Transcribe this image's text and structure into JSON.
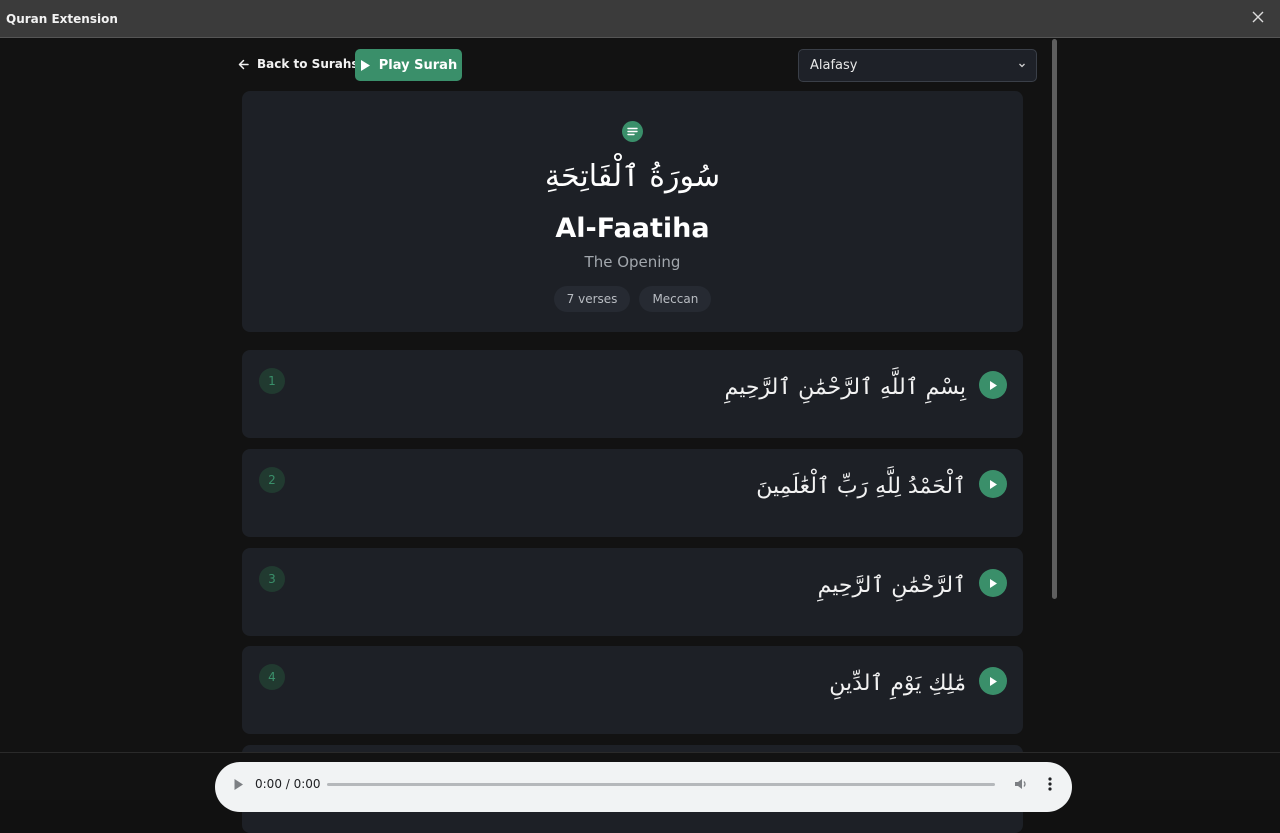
{
  "window": {
    "title": "Quran Extension"
  },
  "toolbar": {
    "back_label": "Back to Surahs",
    "play_label": "Play Surah",
    "reciter_selected": "Alafasy"
  },
  "surah": {
    "arabic_name": "سُورَةُ ٱلْفَاتِحَةِ",
    "english_name": "Al-Faatiha",
    "translation": "The Opening",
    "verses_badge": "7 verses",
    "revelation_badge": "Meccan"
  },
  "verses": [
    {
      "number": "1",
      "text": "بِسْمِ ٱللَّهِ ٱلرَّحْمَٰنِ ٱلرَّحِيمِ"
    },
    {
      "number": "2",
      "text": "ٱلْحَمْدُ لِلَّهِ رَبِّ ٱلْعَٰلَمِينَ"
    },
    {
      "number": "3",
      "text": "ٱلرَّحْمَٰنِ ٱلرَّحِيمِ"
    },
    {
      "number": "4",
      "text": "مَٰلِكِ يَوْمِ ٱلدِّينِ"
    }
  ],
  "audio": {
    "time": "0:00 / 0:00",
    "progress": 0
  },
  "colors": {
    "accent": "#3a8f6a",
    "card": "#1d2026",
    "background": "#121212"
  },
  "icons": [
    "close-icon",
    "arrow-left-icon",
    "play-icon",
    "chevron-down-icon",
    "list-icon",
    "volume-icon",
    "more-vertical-icon"
  ]
}
